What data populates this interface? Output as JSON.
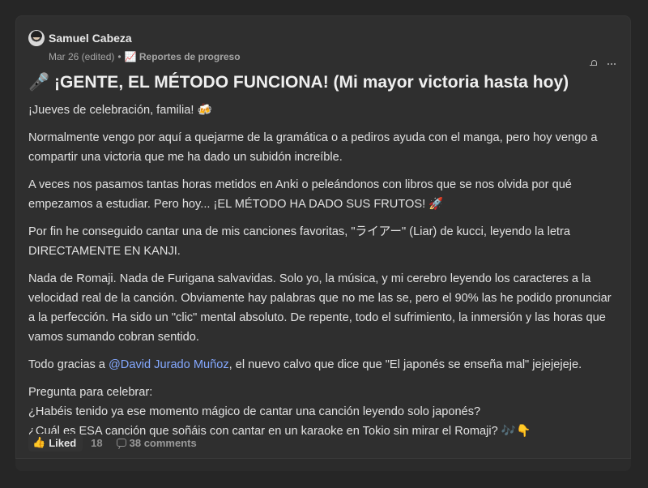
{
  "post": {
    "author": "Samuel Cabeza",
    "timestamp": "Mar 26 (edited)",
    "separator": "•",
    "category": "📈 Reportes de progreso",
    "title": "🎤 ¡GENTE, EL MÉTODO FUNCIONA! (Mi mayor victoria hasta hoy)",
    "body": {
      "p1": "¡Jueves de celebración, familia! 🍻",
      "p2": "Normalmente vengo por aquí a quejarme de la gramática o a pediros ayuda con el manga, pero hoy vengo a compartir una victoria que me ha dado un subidón increíble.",
      "p3": "A veces nos pasamos tantas horas metidos en Anki o peleándonos con libros que se nos olvida por qué empezamos a estudiar. Pero hoy... ¡EL MÉTODO HA DADO SUS FRUTOS! 🚀",
      "p4": "Por fin he conseguido cantar una de mis canciones favoritas, \"ライアー\" (Liar) de kucci, leyendo la letra DIRECTAMENTE EN KANJI.",
      "p5": "Nada de Romaji. Nada de Furigana salvavidas. Solo yo, la música, y mi cerebro leyendo los caracteres a la velocidad real de la canción. Obviamente hay palabras que no me las se, pero el 90% las he podido pronunciar a la perfección. Ha sido un \"clic\" mental absoluto. De repente, todo el sufrimiento, la inmersión y las horas que vamos sumando cobran sentido.",
      "p6_prefix": "Todo gracias a ",
      "p6_mention": "@David Jurado Muñoz",
      "p6_suffix": ", el nuevo calvo que dice que \"El japonés se enseña mal\" jejejejeje.",
      "question_intro": "Pregunta para celebrar:",
      "question_1": "¿Habéis tenido ya ese momento mágico de cantar una canción leyendo solo japonés?",
      "question_2": "¿Cuál es ESA canción que soñáis con cantar en un karaoke en Tokio sin mirar el Romaji? 🎶👇"
    },
    "reactions": {
      "like_icon": "👍",
      "like_label": "Liked",
      "like_count": "18",
      "comments": "38 comments"
    }
  },
  "icons": {
    "bell": "bell-icon",
    "more": "more-icon",
    "comment": "comment-icon"
  },
  "colors": {
    "page_background": "#262626",
    "card_background": "#2f2f2f",
    "mention": "#84a8ff",
    "text": "#e1e1e1"
  }
}
